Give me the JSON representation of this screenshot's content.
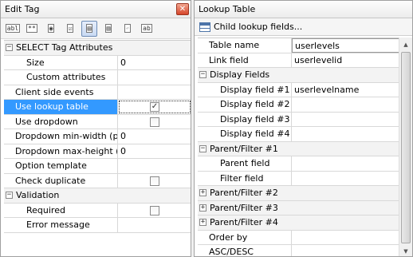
{
  "left": {
    "title": "Edit Tag",
    "close_label": "✕",
    "toolbar": [
      {
        "name": "text-box-tool",
        "glyph": "abl"
      },
      {
        "name": "password-tool",
        "glyph": "**"
      },
      {
        "name": "radio-tool",
        "glyph": "◉"
      },
      {
        "name": "checkbox-tool",
        "glyph": "☑"
      },
      {
        "name": "select-tool",
        "glyph": "▤",
        "active": true
      },
      {
        "name": "listbox-tool",
        "glyph": "▥"
      },
      {
        "name": "undo-tool",
        "glyph": "↶",
        "disabled": true
      },
      {
        "name": "label-tool",
        "glyph": "ab"
      }
    ],
    "rows": [
      {
        "type": "category",
        "label": "SELECT Tag Attributes",
        "expander": "−"
      },
      {
        "type": "prop",
        "label": "Size",
        "value": "0",
        "indent": true
      },
      {
        "type": "prop",
        "label": "Custom attributes",
        "value": "",
        "indent": true
      },
      {
        "type": "prop",
        "label": "Client side events",
        "value": ""
      },
      {
        "type": "prop",
        "label": "Use lookup table",
        "checkbox": true,
        "checked": "✓",
        "selected": true
      },
      {
        "type": "prop",
        "label": "Use dropdown",
        "checkbox": true,
        "checked": ""
      },
      {
        "type": "prop",
        "label": "Dropdown min-width (px)",
        "value": "0"
      },
      {
        "type": "prop",
        "label": "Dropdown max-height (px",
        "value": "0"
      },
      {
        "type": "prop",
        "label": "Option template",
        "value": ""
      },
      {
        "type": "prop",
        "label": "Check duplicate",
        "checkbox": true,
        "checked": ""
      },
      {
        "type": "category",
        "label": "Validation",
        "expander": "−"
      },
      {
        "type": "prop",
        "label": "Required",
        "checkbox": true,
        "checked": "",
        "indent": true
      },
      {
        "type": "prop",
        "label": "Error message",
        "value": "",
        "indent": true
      }
    ]
  },
  "right": {
    "title": "Lookup Table",
    "toolbar_label": "Child lookup fields...",
    "rows": [
      {
        "type": "prop",
        "label": "Table name",
        "value": "userlevels",
        "editing": true
      },
      {
        "type": "prop",
        "label": "Link field",
        "value": "userlevelid"
      },
      {
        "type": "category",
        "label": "Display Fields",
        "expander": "−"
      },
      {
        "type": "prop",
        "label": "Display field #1",
        "value": "userlevelname",
        "indent": true
      },
      {
        "type": "prop",
        "label": "Display field #2",
        "value": "",
        "indent": true
      },
      {
        "type": "prop",
        "label": "Display field #3",
        "value": "",
        "indent": true
      },
      {
        "type": "prop",
        "label": "Display field #4",
        "value": "",
        "indent": true
      },
      {
        "type": "category",
        "label": "Parent/Filter #1",
        "expander": "−"
      },
      {
        "type": "prop",
        "label": "Parent field",
        "value": "",
        "indent": true
      },
      {
        "type": "prop",
        "label": "Filter field",
        "value": "",
        "indent": true
      },
      {
        "type": "category",
        "label": "Parent/Filter #2",
        "expander": "+"
      },
      {
        "type": "category",
        "label": "Parent/Filter #3",
        "expander": "+"
      },
      {
        "type": "category",
        "label": "Parent/Filter #4",
        "expander": "+"
      },
      {
        "type": "prop",
        "label": "Order by",
        "value": ""
      },
      {
        "type": "prop",
        "label": "ASC/DESC",
        "value": ""
      }
    ]
  }
}
